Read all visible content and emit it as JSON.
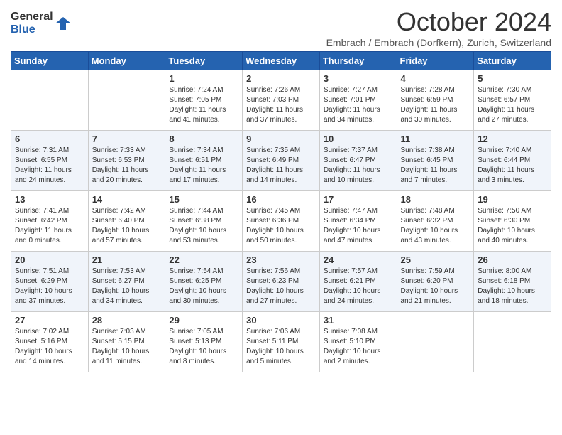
{
  "logo": {
    "general": "General",
    "blue": "Blue"
  },
  "header": {
    "title": "October 2024",
    "subtitle": "Embrach / Embrach (Dorfkern), Zurich, Switzerland"
  },
  "weekdays": [
    "Sunday",
    "Monday",
    "Tuesday",
    "Wednesday",
    "Thursday",
    "Friday",
    "Saturday"
  ],
  "weeks": [
    [
      {
        "day": "",
        "info": ""
      },
      {
        "day": "",
        "info": ""
      },
      {
        "day": "1",
        "sunrise": "Sunrise: 7:24 AM",
        "sunset": "Sunset: 7:05 PM",
        "daylight": "Daylight: 11 hours and 41 minutes."
      },
      {
        "day": "2",
        "sunrise": "Sunrise: 7:26 AM",
        "sunset": "Sunset: 7:03 PM",
        "daylight": "Daylight: 11 hours and 37 minutes."
      },
      {
        "day": "3",
        "sunrise": "Sunrise: 7:27 AM",
        "sunset": "Sunset: 7:01 PM",
        "daylight": "Daylight: 11 hours and 34 minutes."
      },
      {
        "day": "4",
        "sunrise": "Sunrise: 7:28 AM",
        "sunset": "Sunset: 6:59 PM",
        "daylight": "Daylight: 11 hours and 30 minutes."
      },
      {
        "day": "5",
        "sunrise": "Sunrise: 7:30 AM",
        "sunset": "Sunset: 6:57 PM",
        "daylight": "Daylight: 11 hours and 27 minutes."
      }
    ],
    [
      {
        "day": "6",
        "sunrise": "Sunrise: 7:31 AM",
        "sunset": "Sunset: 6:55 PM",
        "daylight": "Daylight: 11 hours and 24 minutes."
      },
      {
        "day": "7",
        "sunrise": "Sunrise: 7:33 AM",
        "sunset": "Sunset: 6:53 PM",
        "daylight": "Daylight: 11 hours and 20 minutes."
      },
      {
        "day": "8",
        "sunrise": "Sunrise: 7:34 AM",
        "sunset": "Sunset: 6:51 PM",
        "daylight": "Daylight: 11 hours and 17 minutes."
      },
      {
        "day": "9",
        "sunrise": "Sunrise: 7:35 AM",
        "sunset": "Sunset: 6:49 PM",
        "daylight": "Daylight: 11 hours and 14 minutes."
      },
      {
        "day": "10",
        "sunrise": "Sunrise: 7:37 AM",
        "sunset": "Sunset: 6:47 PM",
        "daylight": "Daylight: 11 hours and 10 minutes."
      },
      {
        "day": "11",
        "sunrise": "Sunrise: 7:38 AM",
        "sunset": "Sunset: 6:45 PM",
        "daylight": "Daylight: 11 hours and 7 minutes."
      },
      {
        "day": "12",
        "sunrise": "Sunrise: 7:40 AM",
        "sunset": "Sunset: 6:44 PM",
        "daylight": "Daylight: 11 hours and 3 minutes."
      }
    ],
    [
      {
        "day": "13",
        "sunrise": "Sunrise: 7:41 AM",
        "sunset": "Sunset: 6:42 PM",
        "daylight": "Daylight: 11 hours and 0 minutes."
      },
      {
        "day": "14",
        "sunrise": "Sunrise: 7:42 AM",
        "sunset": "Sunset: 6:40 PM",
        "daylight": "Daylight: 10 hours and 57 minutes."
      },
      {
        "day": "15",
        "sunrise": "Sunrise: 7:44 AM",
        "sunset": "Sunset: 6:38 PM",
        "daylight": "Daylight: 10 hours and 53 minutes."
      },
      {
        "day": "16",
        "sunrise": "Sunrise: 7:45 AM",
        "sunset": "Sunset: 6:36 PM",
        "daylight": "Daylight: 10 hours and 50 minutes."
      },
      {
        "day": "17",
        "sunrise": "Sunrise: 7:47 AM",
        "sunset": "Sunset: 6:34 PM",
        "daylight": "Daylight: 10 hours and 47 minutes."
      },
      {
        "day": "18",
        "sunrise": "Sunrise: 7:48 AM",
        "sunset": "Sunset: 6:32 PM",
        "daylight": "Daylight: 10 hours and 43 minutes."
      },
      {
        "day": "19",
        "sunrise": "Sunrise: 7:50 AM",
        "sunset": "Sunset: 6:30 PM",
        "daylight": "Daylight: 10 hours and 40 minutes."
      }
    ],
    [
      {
        "day": "20",
        "sunrise": "Sunrise: 7:51 AM",
        "sunset": "Sunset: 6:29 PM",
        "daylight": "Daylight: 10 hours and 37 minutes."
      },
      {
        "day": "21",
        "sunrise": "Sunrise: 7:53 AM",
        "sunset": "Sunset: 6:27 PM",
        "daylight": "Daylight: 10 hours and 34 minutes."
      },
      {
        "day": "22",
        "sunrise": "Sunrise: 7:54 AM",
        "sunset": "Sunset: 6:25 PM",
        "daylight": "Daylight: 10 hours and 30 minutes."
      },
      {
        "day": "23",
        "sunrise": "Sunrise: 7:56 AM",
        "sunset": "Sunset: 6:23 PM",
        "daylight": "Daylight: 10 hours and 27 minutes."
      },
      {
        "day": "24",
        "sunrise": "Sunrise: 7:57 AM",
        "sunset": "Sunset: 6:21 PM",
        "daylight": "Daylight: 10 hours and 24 minutes."
      },
      {
        "day": "25",
        "sunrise": "Sunrise: 7:59 AM",
        "sunset": "Sunset: 6:20 PM",
        "daylight": "Daylight: 10 hours and 21 minutes."
      },
      {
        "day": "26",
        "sunrise": "Sunrise: 8:00 AM",
        "sunset": "Sunset: 6:18 PM",
        "daylight": "Daylight: 10 hours and 18 minutes."
      }
    ],
    [
      {
        "day": "27",
        "sunrise": "Sunrise: 7:02 AM",
        "sunset": "Sunset: 5:16 PM",
        "daylight": "Daylight: 10 hours and 14 minutes."
      },
      {
        "day": "28",
        "sunrise": "Sunrise: 7:03 AM",
        "sunset": "Sunset: 5:15 PM",
        "daylight": "Daylight: 10 hours and 11 minutes."
      },
      {
        "day": "29",
        "sunrise": "Sunrise: 7:05 AM",
        "sunset": "Sunset: 5:13 PM",
        "daylight": "Daylight: 10 hours and 8 minutes."
      },
      {
        "day": "30",
        "sunrise": "Sunrise: 7:06 AM",
        "sunset": "Sunset: 5:11 PM",
        "daylight": "Daylight: 10 hours and 5 minutes."
      },
      {
        "day": "31",
        "sunrise": "Sunrise: 7:08 AM",
        "sunset": "Sunset: 5:10 PM",
        "daylight": "Daylight: 10 hours and 2 minutes."
      },
      {
        "day": "",
        "info": ""
      },
      {
        "day": "",
        "info": ""
      }
    ]
  ]
}
